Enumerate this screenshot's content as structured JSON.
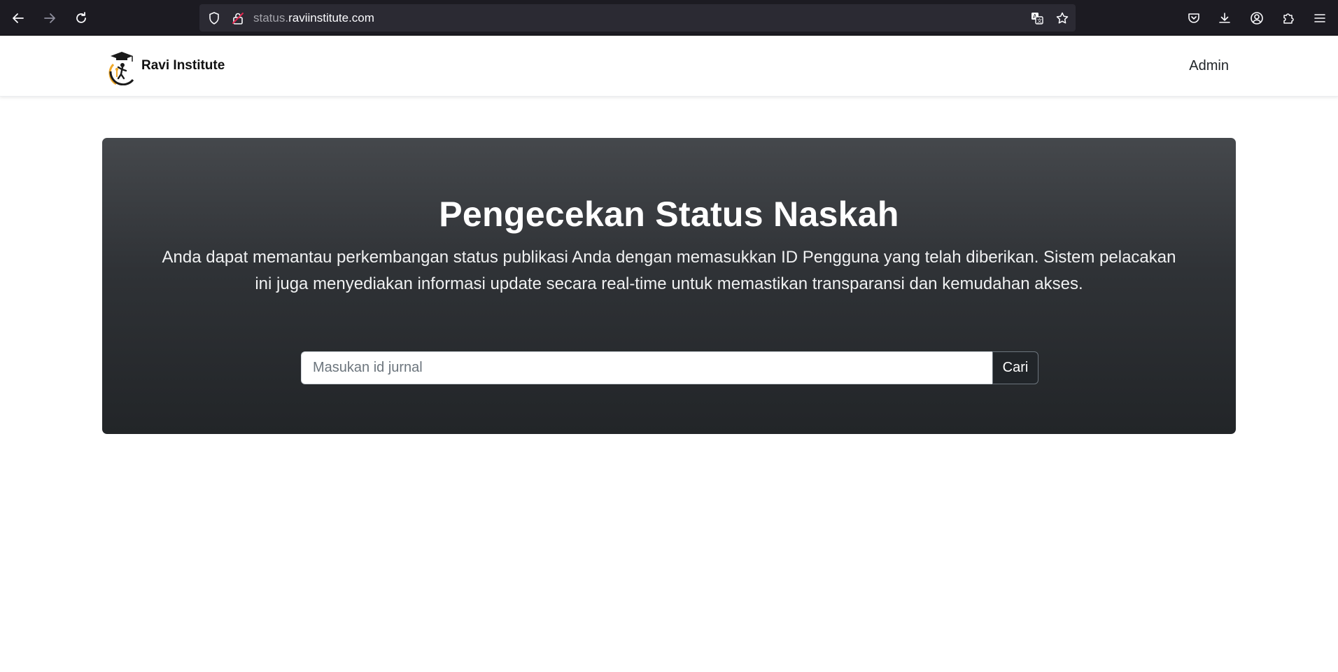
{
  "browser": {
    "url_prefix": "status.",
    "url_domain": "raviinstitute.com",
    "icons": {
      "back": "arrow-left-icon",
      "forward": "arrow-right-icon",
      "reload": "reload-icon",
      "shield": "shield-icon",
      "lock": "insecure-lock-icon",
      "translate": "translate-icon",
      "bookmark": "star-icon",
      "pocket": "pocket-icon",
      "downloads": "download-icon",
      "account": "account-icon",
      "extensions": "extensions-icon",
      "menu": "hamburger-menu-icon"
    }
  },
  "navbar": {
    "brand_name": "Ravi Institute",
    "admin_link": "Admin"
  },
  "hero": {
    "title": "Pengecekan Status Naskah",
    "description": "Anda dapat memantau perkembangan status publikasi Anda dengan memasukkan ID Pengguna yang telah diberikan. Sistem pelacakan ini juga menyediakan informasi update secara real-time untuk memastikan transparansi dan kemudahan akses.",
    "search": {
      "placeholder": "Masukan id jurnal",
      "value": "",
      "button_label": "Cari"
    }
  },
  "colors": {
    "browser_bg": "#1c1b22",
    "urlbar_bg": "#2b2a33",
    "hero_top": "#45484c",
    "hero_bottom": "#222528",
    "button_bg": "#212529",
    "logo_gold": "#f0a92a"
  }
}
